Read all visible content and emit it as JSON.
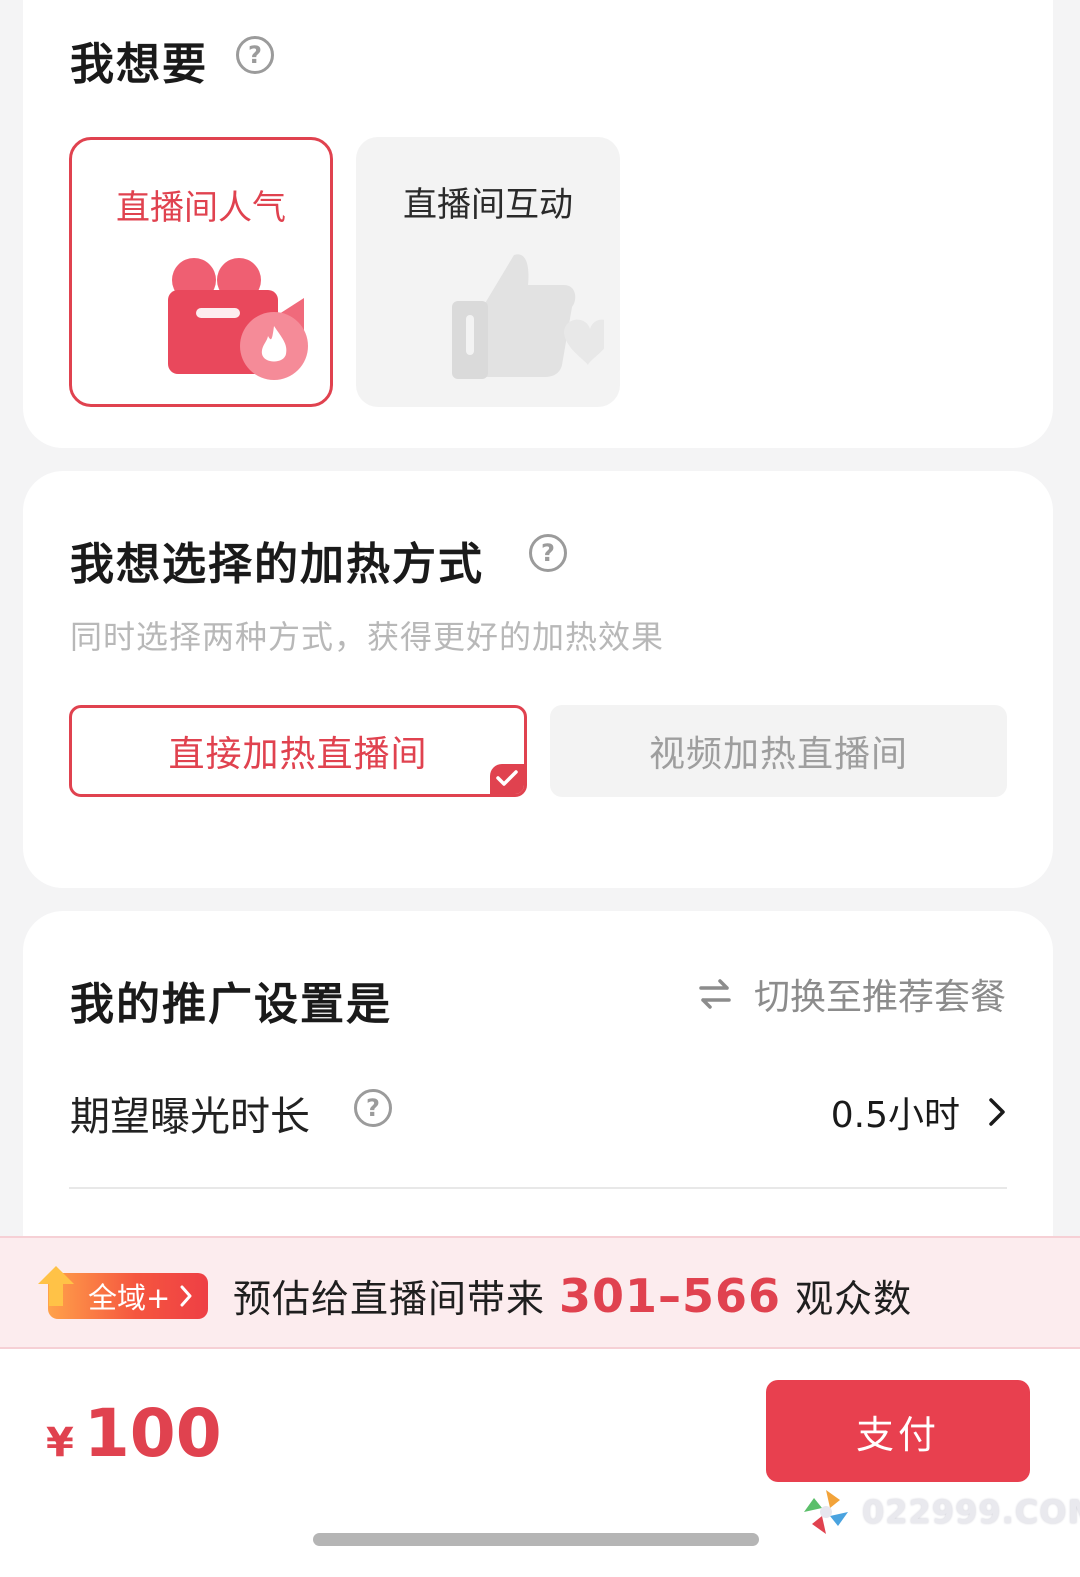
{
  "goal": {
    "title": "我想要",
    "help_icon": "question-circle-icon",
    "options": [
      {
        "label": "直播间人气",
        "icon": "video-camera-fire-icon",
        "selected": true
      },
      {
        "label": "直播间互动",
        "icon": "thumbs-up-heart-icon",
        "selected": false
      }
    ]
  },
  "method": {
    "title": "我想选择的加热方式",
    "subtitle": "同时选择两种方式，获得更好的加热效果",
    "options": [
      {
        "label": "直接加热直播间",
        "selected": true
      },
      {
        "label": "视频加热直播间",
        "selected": false
      }
    ]
  },
  "settings": {
    "title": "我的推广设置是",
    "switch_label": "切换至推荐套餐",
    "exposure_label": "期望曝光时长",
    "exposure_value": "0.5小时"
  },
  "estimate": {
    "badge": "全域+",
    "prefix": "预估给直播间带来",
    "range": "301–566",
    "suffix": "观众数"
  },
  "footer": {
    "currency": "¥",
    "price": "100",
    "pay_label": "支付",
    "watermark": "022999.COM"
  },
  "colors": {
    "accent": "#e0424f",
    "pay_button": "#e8404f",
    "banner_bg": "#fcecee"
  }
}
